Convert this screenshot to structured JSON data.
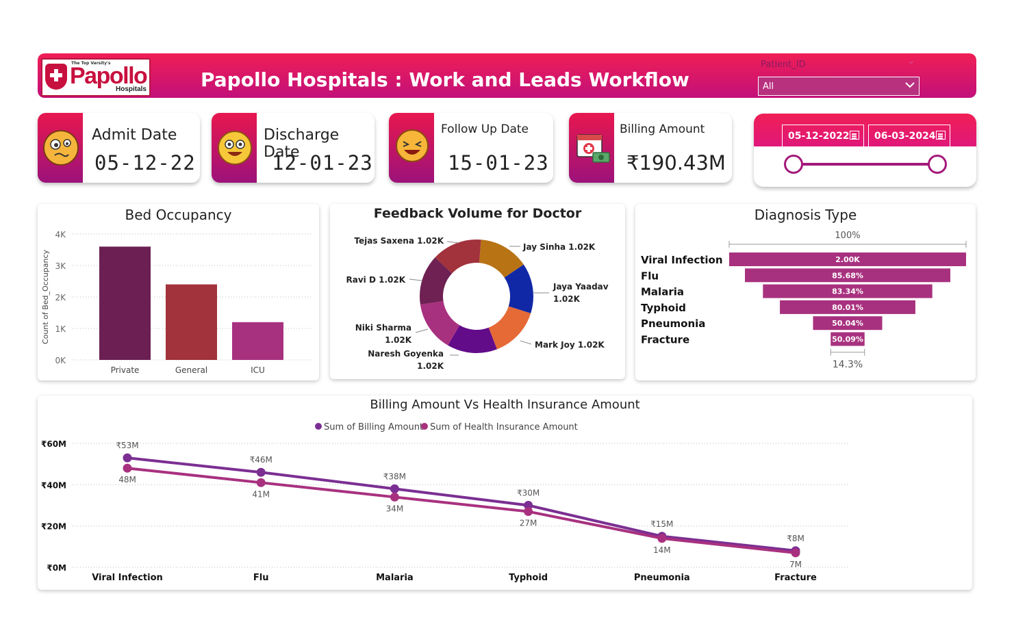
{
  "header": {
    "logo_tagline": "The Top Varsity's",
    "logo_name": "Papollo",
    "logo_sub": "Hospitals",
    "title": "Papollo Hospitals : Work and Leads Workflow",
    "slicer_label": "Patient_ID",
    "slicer_value": "All"
  },
  "cards": [
    {
      "label": "Admit Date",
      "value": "05-12-22",
      "icon": "confused-emoji-icon"
    },
    {
      "label": "Discharge Date",
      "value": "12-01-23",
      "icon": "happy-emoji-icon"
    },
    {
      "label": "Follow Up Date",
      "value": "15-01-23",
      "icon": "laughing-emoji-icon"
    },
    {
      "label": "Billing Amount",
      "value": "₹190.43M",
      "icon": "medical-bill-icon"
    }
  ],
  "date_range": {
    "start": "05-12-2022",
    "end": "06-03-2024"
  },
  "colors": {
    "accent": "#e8174f",
    "accent_dark": "#9c127a",
    "private": "#6b1f52",
    "general": "#a2323c",
    "icu": "#a8317f",
    "billing_line": "#7b2f92",
    "insurance_line": "#a8317f"
  },
  "bed_occupancy": {
    "title": "Bed Occupancy",
    "chart_data": {
      "type": "bar",
      "categories": [
        "Private",
        "General",
        "ICU"
      ],
      "values": [
        3600,
        2400,
        1200
      ],
      "ylabel": "Count of Bed_Occupancy",
      "yticks": [
        "0K",
        "1K",
        "2K",
        "3K",
        "4K"
      ],
      "ylim": [
        0,
        4000
      ]
    }
  },
  "feedback": {
    "title": "Feedback Volume for Doctor",
    "chart_data": {
      "type": "pie",
      "slices": [
        {
          "name": "Jay Sinha",
          "value": 1.02,
          "label": "Jay Sinha 1.02K",
          "color": "#b87314"
        },
        {
          "name": "Jaya Yaadav",
          "value": 1.02,
          "label_lines": [
            "Jaya Yaadav",
            "1.02K"
          ],
          "color": "#1128a6"
        },
        {
          "name": "Mark Joy",
          "value": 1.02,
          "label": "Mark Joy 1.02K",
          "color": "#e66a36"
        },
        {
          "name": "Naresh Goyenka",
          "value": 1.02,
          "label_lines": [
            "Naresh Goyenka",
            "1.02K"
          ],
          "color": "#620c8a"
        },
        {
          "name": "Niki Sharma",
          "value": 1.02,
          "label_lines": [
            "Niki Sharma",
            "1.02K"
          ],
          "color": "#a8317f"
        },
        {
          "name": "Ravi D",
          "value": 1.02,
          "label": "Ravi D 1.02K",
          "color": "#6e2152"
        },
        {
          "name": "Tejas Saxena",
          "value": 1.02,
          "label": "Tejas Saxena 1.02K",
          "color": "#a2323c"
        }
      ]
    }
  },
  "diagnosis": {
    "title": "Diagnosis Type",
    "top_label": "100%",
    "bottom_label": "14.3%",
    "chart_data": {
      "type": "bar",
      "categories": [
        "Viral Infection",
        "Flu",
        "Malaria",
        "Typhoid",
        "Pneumonia",
        "Fracture"
      ],
      "values": [
        100,
        85.68,
        83.34,
        80.01,
        50.04,
        50.09
      ],
      "value_labels": [
        "2.00K",
        "85.68%",
        "83.34%",
        "80.01%",
        "50.04%",
        "50.09%"
      ],
      "bar_widths_pct": [
        100,
        86.7,
        71.5,
        57.2,
        29.2,
        14.3
      ]
    }
  },
  "billing": {
    "title": "Billing Amount Vs Health Insurance Amount",
    "legend": [
      "Sum of Billing Amount",
      "Sum of Health Insurance Amount"
    ],
    "chart_data": {
      "type": "line",
      "categories": [
        "Viral Infection",
        "Flu",
        "Malaria",
        "Typhoid",
        "Pneumonia",
        "Fracture"
      ],
      "series": [
        {
          "name": "Sum of Billing Amount",
          "values": [
            53,
            46,
            38,
            30,
            15,
            8
          ],
          "labels": [
            "₹53M",
            "₹46M",
            "₹38M",
            "₹30M",
            "₹15M",
            "₹8M"
          ]
        },
        {
          "name": "Sum of Health Insurance Amount",
          "values": [
            48,
            41,
            34,
            27,
            14,
            7
          ],
          "labels": [
            "48M",
            "41M",
            "34M",
            "27M",
            "14M",
            "7M"
          ]
        }
      ],
      "yticks": [
        "₹0M",
        "₹20M",
        "₹40M",
        "₹60M"
      ],
      "ylim": [
        0,
        60
      ]
    }
  }
}
